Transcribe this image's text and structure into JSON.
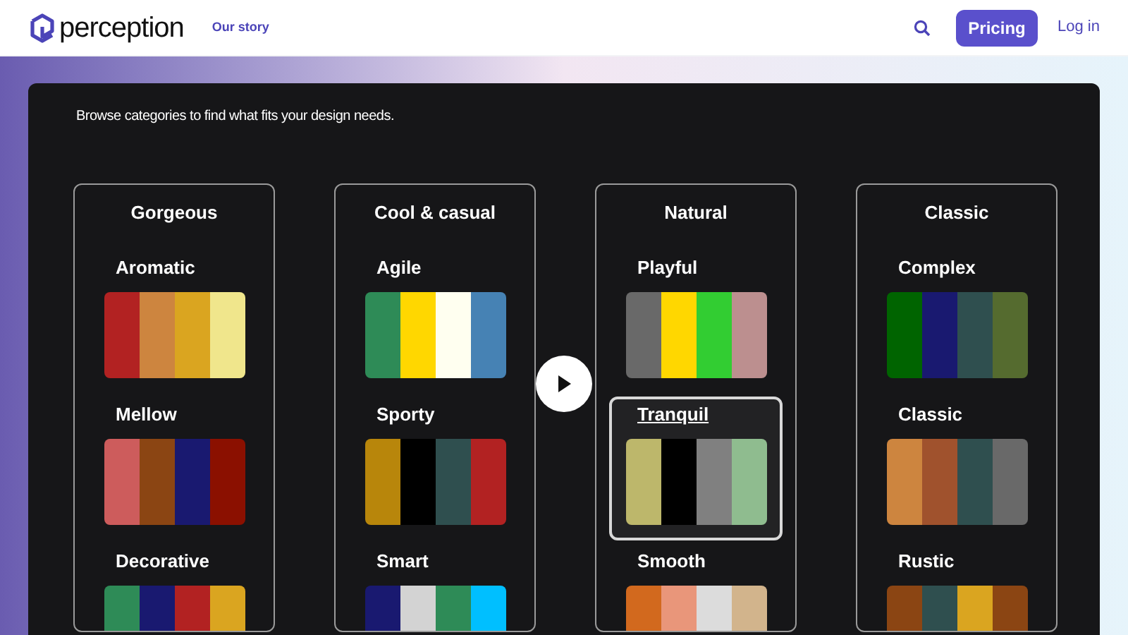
{
  "header": {
    "logo": "perception",
    "nav": [
      "Our story"
    ],
    "pricing_button": "Pricing",
    "login_link": "Log in"
  },
  "intro": {
    "subtitle": "Browse categories to find what fits your design needs."
  },
  "categories": [
    {
      "title": "Gorgeous",
      "palettes": [
        {
          "name": "Aromatic",
          "selected": false,
          "swatches": [
            {
              "color": "#b22222"
            },
            {
              "color": "#cd853f"
            },
            {
              "color": "#daa520"
            },
            {
              "color": "#f0e68c"
            }
          ]
        },
        {
          "name": "Mellow",
          "selected": false,
          "swatches": [
            {
              "color": "#cd5c5c"
            },
            {
              "color": "#8b4513"
            },
            {
              "color": "#191970"
            },
            {
              "color": "#8b1000"
            }
          ]
        },
        {
          "name": "Decorative",
          "selected": false,
          "swatches": [
            {
              "color": "#2e8b57"
            },
            {
              "color": "#191970"
            },
            {
              "color": "#b22222"
            },
            {
              "color": "#daa520"
            }
          ]
        }
      ]
    },
    {
      "title": "Cool & casual",
      "palettes": [
        {
          "name": "Agile",
          "selected": false,
          "swatches": [
            {
              "color": "#2e8b57"
            },
            {
              "color": "#ffd700"
            },
            {
              "color": "#fffff0"
            },
            {
              "color": "#4682b4"
            }
          ]
        },
        {
          "name": "Sporty",
          "selected": false,
          "swatches": [
            {
              "color": "#b8860b"
            },
            {
              "color": "#000000"
            },
            {
              "color": "#2f4f4f"
            },
            {
              "color": "#b22222"
            }
          ]
        },
        {
          "name": "Smart",
          "selected": false,
          "swatches": [
            {
              "color": "#191970"
            },
            {
              "color": "#d3d3d3"
            },
            {
              "color": "#2e8b57"
            },
            {
              "color": "#00bfff"
            }
          ]
        }
      ]
    },
    {
      "title": "Natural",
      "palettes": [
        {
          "name": "Playful",
          "selected": false,
          "swatches": [
            {
              "color": "#696969"
            },
            {
              "color": "#ffd700"
            },
            {
              "color": "#32cd32"
            },
            {
              "color": "#bc8f8f"
            }
          ]
        },
        {
          "name": "Tranquil",
          "selected": true,
          "swatches": [
            {
              "color": "#bdb76b"
            },
            {
              "color": "#000000"
            },
            {
              "color": "#808080"
            },
            {
              "color": "#8fbc8f"
            }
          ]
        },
        {
          "name": "Smooth",
          "selected": false,
          "swatches": [
            {
              "color": "#d2691e"
            },
            {
              "color": "#e9967a"
            },
            {
              "color": "#dcdcdc"
            },
            {
              "color": "#d2b48c"
            }
          ]
        }
      ]
    },
    {
      "title": "Classic",
      "palettes": [
        {
          "name": "Complex",
          "selected": false,
          "swatches": [
            {
              "color": "#006400"
            },
            {
              "color": "#191970"
            },
            {
              "color": "#2f4f4f"
            },
            {
              "color": "#556b2f"
            }
          ]
        },
        {
          "name": "Classic",
          "selected": false,
          "swatches": [
            {
              "color": "#cd853f"
            },
            {
              "color": "#a0522d"
            },
            {
              "color": "#2f4f4f"
            },
            {
              "color": "#696969"
            }
          ]
        },
        {
          "name": "Rustic",
          "selected": false,
          "swatches": [
            {
              "color": "#8b4513"
            },
            {
              "color": "#2f4f4f"
            },
            {
              "color": "#daa520"
            },
            {
              "color": "#8b4513"
            }
          ]
        }
      ]
    }
  ]
}
